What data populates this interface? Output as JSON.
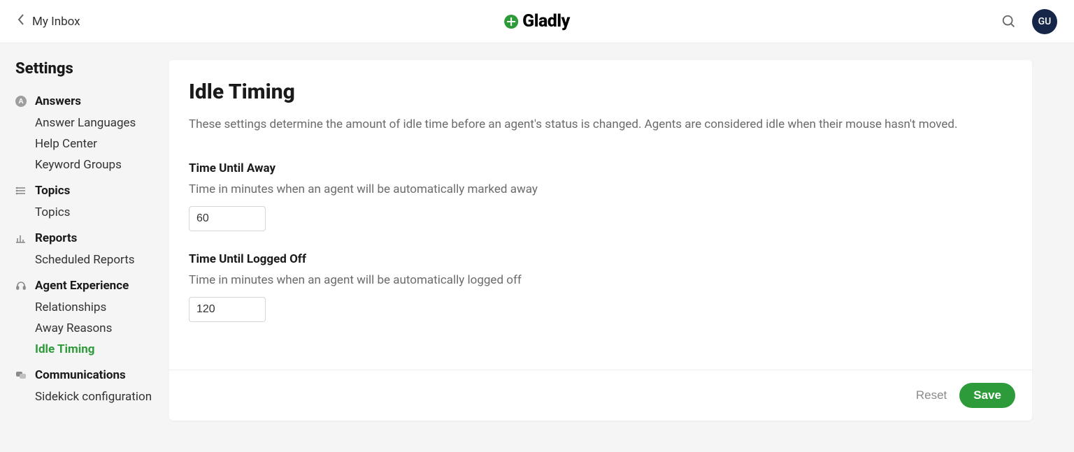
{
  "topbar": {
    "back_label": "My Inbox",
    "brand_name": "Gladly",
    "avatar_initials": "GU"
  },
  "sidebar": {
    "title": "Settings",
    "groups": [
      {
        "label": "Answers",
        "items": [
          {
            "label": "Answer Languages"
          },
          {
            "label": "Help Center"
          },
          {
            "label": "Keyword Groups"
          }
        ]
      },
      {
        "label": "Topics",
        "items": [
          {
            "label": "Topics"
          }
        ]
      },
      {
        "label": "Reports",
        "items": [
          {
            "label": "Scheduled Reports"
          }
        ]
      },
      {
        "label": "Agent Experience",
        "items": [
          {
            "label": "Relationships"
          },
          {
            "label": "Away Reasons"
          },
          {
            "label": "Idle Timing",
            "active": true
          }
        ]
      },
      {
        "label": "Communications",
        "items": [
          {
            "label": "Sidekick configuration"
          }
        ]
      }
    ]
  },
  "main": {
    "title": "Idle Timing",
    "description": "These settings determine the amount of idle time before an agent's status is changed. Agents are considered idle when their mouse hasn't moved.",
    "fields": {
      "away": {
        "label": "Time Until Away",
        "help": "Time in minutes when an agent will be automatically marked away",
        "value": "60"
      },
      "logoff": {
        "label": "Time Until Logged Off",
        "help": "Time in minutes when an agent will be automatically logged off",
        "value": "120"
      }
    },
    "footer": {
      "reset_label": "Reset",
      "save_label": "Save"
    }
  }
}
